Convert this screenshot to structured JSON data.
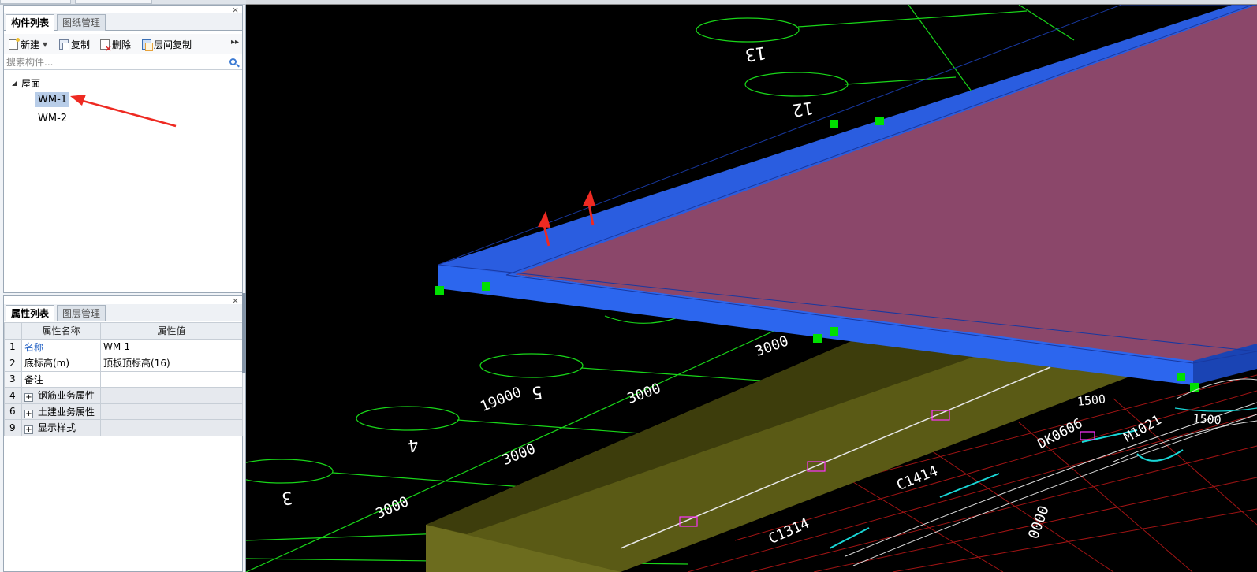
{
  "component_panel": {
    "tabs": [
      {
        "label": "构件列表",
        "active": true
      },
      {
        "label": "图纸管理",
        "active": false
      }
    ],
    "toolbar": {
      "new_label": "新建",
      "copy_label": "复制",
      "delete_label": "删除",
      "floor_copy_label": "层间复制",
      "more": "▸▸"
    },
    "search_placeholder": "搜索构件...",
    "tree": {
      "root_label": "屋面",
      "items": [
        {
          "label": "WM-1",
          "selected": true
        },
        {
          "label": "WM-2",
          "selected": false
        }
      ]
    },
    "close": "×"
  },
  "property_panel": {
    "tabs": [
      {
        "label": "属性列表",
        "active": true
      },
      {
        "label": "图层管理",
        "active": false
      }
    ],
    "close": "×",
    "columns": [
      "属性名称",
      "属性值"
    ],
    "rows": [
      {
        "num": "1",
        "name": "名称",
        "value": "WM-1",
        "group": false,
        "link": true
      },
      {
        "num": "2",
        "name": "底标高(m)",
        "value": "顶板顶标高(16)",
        "group": false,
        "link": false
      },
      {
        "num": "3",
        "name": "备注",
        "value": "",
        "group": false,
        "link": false
      },
      {
        "num": "4",
        "name": "钢筋业务属性",
        "value": "",
        "group": true,
        "link": false
      },
      {
        "num": "6",
        "name": "土建业务属性",
        "value": "",
        "group": true,
        "link": false
      },
      {
        "num": "9",
        "name": "显示样式",
        "value": "",
        "group": true,
        "link": false
      }
    ],
    "expander_symbol": "+"
  },
  "viewport": {
    "axis_bubbles": [
      "13",
      "12",
      "5",
      "4",
      "3"
    ],
    "dimension_labels": [
      "3000",
      "19000",
      "3000",
      "3000",
      "3000",
      "1500",
      "1500",
      "0000"
    ],
    "drawing_text": [
      "C1414",
      "C1314",
      "DK0606",
      "M1021"
    ],
    "colors": {
      "background": "#000000",
      "axis_green": "#19d619",
      "slab_top": "#8b476a",
      "slab_edge": "#2a5de0",
      "wall_olive": "#5a5a15",
      "grip_green": "#00e000",
      "annotation_red": "#ee2a22",
      "grid_red": "#a01414"
    }
  }
}
